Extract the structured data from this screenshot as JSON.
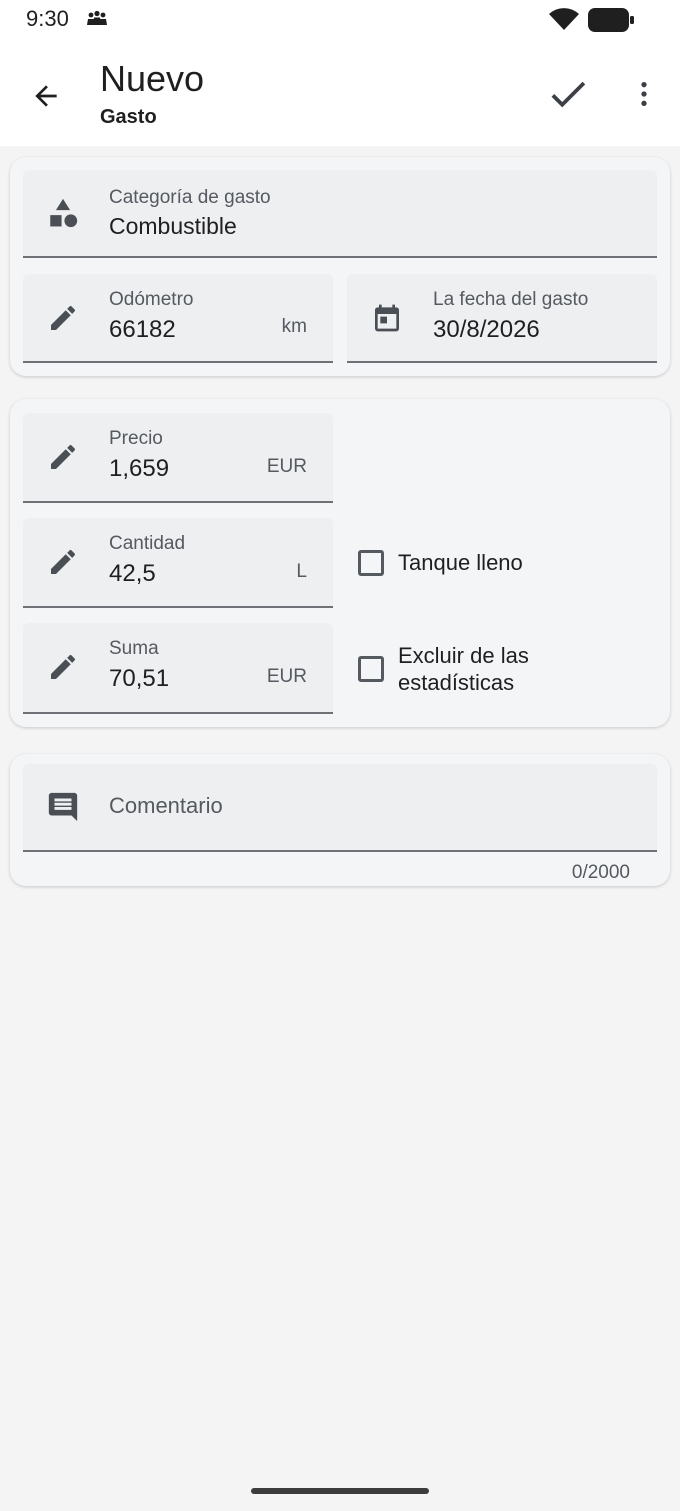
{
  "status_bar": {
    "time": "9:30"
  },
  "app_bar": {
    "title": "Nuevo",
    "subtitle": "Gasto"
  },
  "icons": {
    "back": "arrow-back-icon",
    "confirm": "check-icon",
    "more": "more-vert-icon",
    "category": "shapes-icon",
    "edit": "pencil-icon",
    "calendar": "calendar-icon",
    "comment": "comment-icon"
  },
  "general_card": {
    "category": {
      "label": "Categoría de gasto",
      "value": "Combustible"
    },
    "odometer": {
      "label": "Odómetro",
      "value": "66182",
      "unit": "km"
    },
    "date": {
      "label": "La fecha del gasto",
      "value": "30/8/2026"
    }
  },
  "fuel_card": {
    "price": {
      "label": "Precio",
      "value": "1,659",
      "unit": "EUR"
    },
    "quantity": {
      "label": "Cantidad",
      "value": "42,5",
      "unit": "L"
    },
    "sum": {
      "label": "Suma",
      "value": "70,51",
      "unit": "EUR"
    },
    "full_tank": {
      "label": "Tanque lleno",
      "checked": false
    },
    "exclude_stats": {
      "label_line1": "Excluir de las",
      "label_line2": "estadísticas",
      "checked": false
    }
  },
  "comment_card": {
    "placeholder": "Comentario",
    "counter": "0/2000"
  },
  "colors": {
    "icon": "#4a4f55",
    "field_bg": "#eeeff1",
    "card_bg": "#f4f5f7",
    "page_bg": "#f4f4f4"
  }
}
